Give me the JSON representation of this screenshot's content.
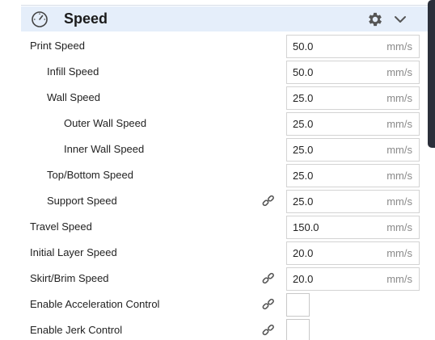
{
  "section": {
    "title": "Speed"
  },
  "settings": [
    {
      "label": "Print Speed",
      "value": "50.0",
      "unit": "mm/s"
    },
    {
      "label": "Infill Speed",
      "value": "50.0",
      "unit": "mm/s"
    },
    {
      "label": "Wall Speed",
      "value": "25.0",
      "unit": "mm/s"
    },
    {
      "label": "Outer Wall Speed",
      "value": "25.0",
      "unit": "mm/s"
    },
    {
      "label": "Inner Wall Speed",
      "value": "25.0",
      "unit": "mm/s"
    },
    {
      "label": "Top/Bottom Speed",
      "value": "25.0",
      "unit": "mm/s"
    },
    {
      "label": "Support Speed",
      "value": "25.0",
      "unit": "mm/s",
      "linked": true
    },
    {
      "label": "Travel Speed",
      "value": "150.0",
      "unit": "mm/s"
    },
    {
      "label": "Initial Layer Speed",
      "value": "20.0",
      "unit": "mm/s"
    },
    {
      "label": "Skirt/Brim Speed",
      "value": "20.0",
      "unit": "mm/s",
      "linked": true
    },
    {
      "label": "Enable Acceleration Control",
      "checkbox": true,
      "checked": false,
      "linked": true
    },
    {
      "label": "Enable Jerk Control",
      "checkbox": true,
      "checked": false,
      "linked": true
    }
  ],
  "icons": {
    "section": "speedometer-icon",
    "settings": "gear-icon",
    "collapse": "chevron-down-icon",
    "link": "link-icon"
  },
  "colors": {
    "header_bg": "#e5eefa",
    "field_border": "#d3d3d3",
    "unit_text": "#8a8a8a",
    "icon": "#555555"
  }
}
